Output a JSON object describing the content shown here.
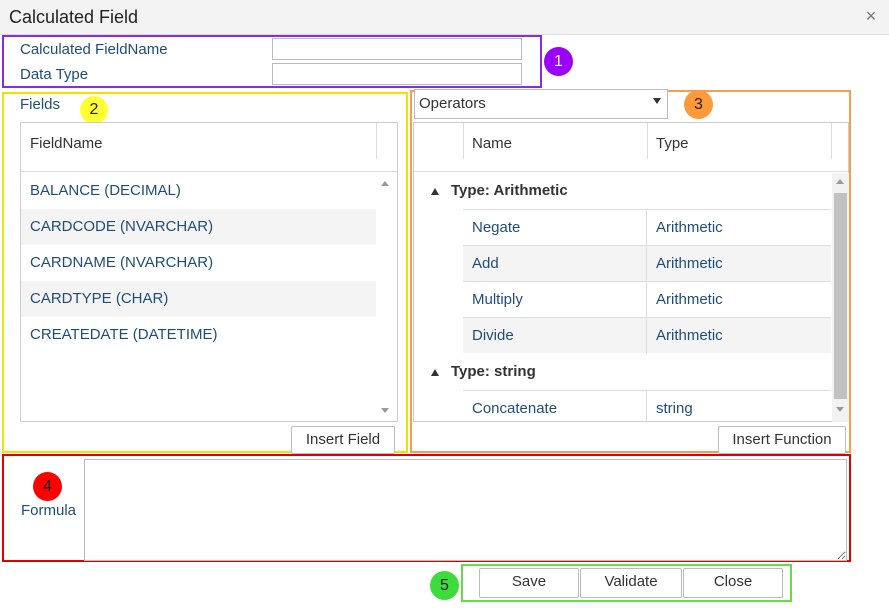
{
  "dialog": {
    "title": "Calculated Field",
    "close_glyph": "×"
  },
  "section1": {
    "badge": "1",
    "fieldname_label": "Calculated FieldName",
    "fieldname_value": "",
    "datatype_label": "Data Type",
    "datatype_value": ""
  },
  "section2": {
    "badge": "2",
    "label": "Fields",
    "column_header": "FieldName",
    "rows": [
      "BALANCE (DECIMAL)",
      "CARDCODE (NVARCHAR)",
      "CARDNAME (NVARCHAR)",
      "CARDTYPE (CHAR)",
      "CREATEDATE (DATETIME)"
    ],
    "insert_button": "Insert Field"
  },
  "section3": {
    "badge": "3",
    "dropdown_value": "Operators",
    "columns": [
      "Name",
      "Type"
    ],
    "groups": [
      {
        "label": "Type: Arithmetic",
        "rows": [
          {
            "name": "Negate",
            "type": "Arithmetic"
          },
          {
            "name": "Add",
            "type": "Arithmetic"
          },
          {
            "name": "Multiply",
            "type": "Arithmetic"
          },
          {
            "name": "Divide",
            "type": "Arithmetic"
          }
        ]
      },
      {
        "label": "Type: string",
        "rows": [
          {
            "name": "Concatenate",
            "type": "string"
          }
        ]
      }
    ],
    "insert_button": "Insert Function"
  },
  "section4": {
    "badge": "4",
    "label": "Formula",
    "value": ""
  },
  "section5": {
    "badge": "5",
    "save_label": "Save",
    "validate_label": "Validate",
    "close_label": "Close"
  },
  "colors": {
    "box1": "#8a2be2",
    "box2": "#e6e600",
    "box3": "#f0a050",
    "box4": "#e00000",
    "box5": "#66dd44",
    "label_text": "#1f4d7a"
  },
  "icons": {
    "dialog_close": "close-icon",
    "scroll_up": "scroll-up-arrow-icon",
    "scroll_down": "scroll-down-arrow-icon",
    "dropdown": "caret-down-icon",
    "group_toggle": "collapse-triangle-icon"
  }
}
